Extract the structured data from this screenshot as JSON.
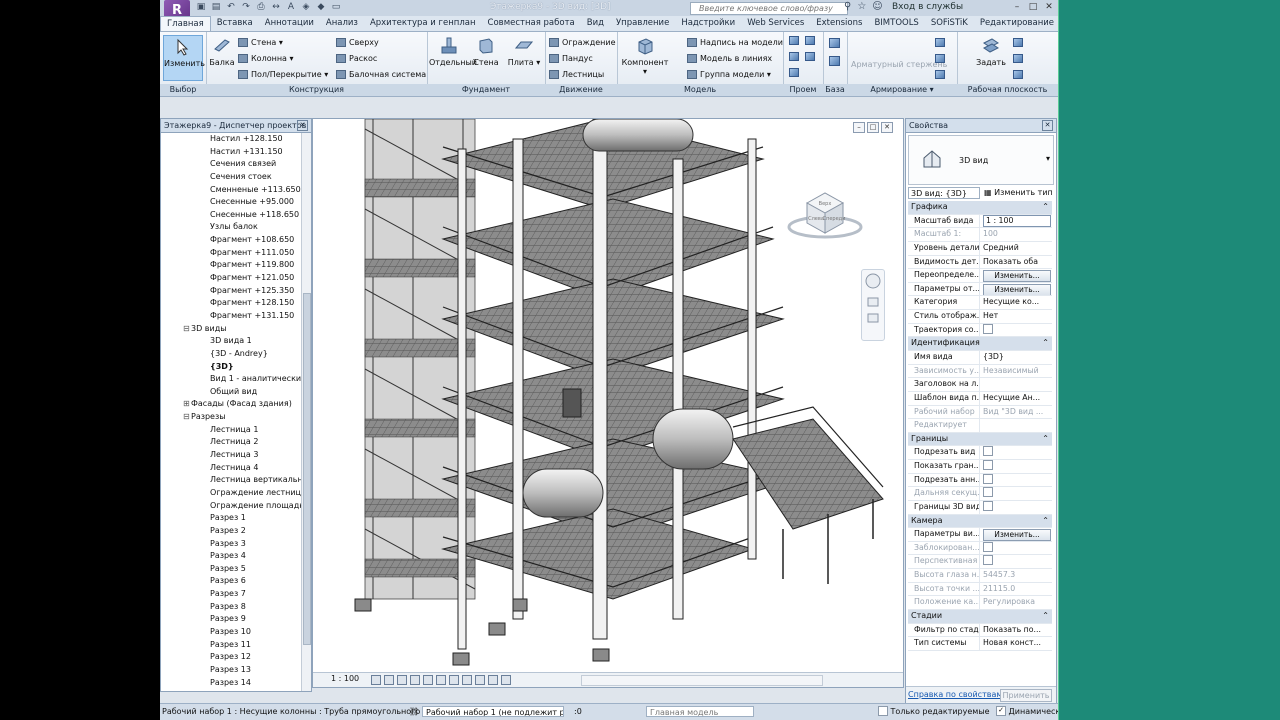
{
  "window": {
    "title": "Этажерка9 - 3D вид: [3D]",
    "search_placeholder": "Введите ключевое слово/фразу",
    "signin": "Вход в службы"
  },
  "tabs": [
    "Главная",
    "Вставка",
    "Аннотации",
    "Анализ",
    "Архитектура и генплан",
    "Совместная работа",
    "Вид",
    "Управление",
    "Надстройки",
    "Web Services",
    "Extensions",
    "BIMTOOLS",
    "SOFiSTiK",
    "Редактирование"
  ],
  "active_tab": "Главная",
  "ribbon": {
    "select": {
      "button": "Изменить",
      "title": "Выбор"
    },
    "structure": {
      "title": "Конструкция",
      "beam": "Балка",
      "wall": "Стена",
      "column": "Колонна",
      "floor": "Пол/Перекрытие",
      "truss": "Сверху",
      "brace": "Раскос",
      "beam_system": "Балочная система"
    },
    "foundation": {
      "title": "Фундамент",
      "isolated": "Отдельный",
      "wall": "Стена",
      "slab": "Плита"
    },
    "circulation": {
      "title": "Движение",
      "railing": "Ограждение",
      "ramp": "Пандус",
      "stair": "Лестницы"
    },
    "model": {
      "title": "Модель",
      "component": "Компонент",
      "model_text": "Надпись на модели",
      "model_line": "Модель в линиях",
      "model_group": "Группа модели"
    },
    "opening": {
      "title": "Проем"
    },
    "datum": {
      "title": "База"
    },
    "reinforcement": {
      "title": "Армирование",
      "rebar_area": "Арматурный стержень"
    },
    "workplane": {
      "title": "Рабочая плоскость",
      "set": "Задать"
    }
  },
  "project_browser": {
    "title": "Этажерка9 - Диспетчер проектов",
    "items": [
      {
        "label": "Настил +128.150",
        "level": 2
      },
      {
        "label": "Настил +131.150",
        "level": 2
      },
      {
        "label": "Сечения связей",
        "level": 2
      },
      {
        "label": "Сечения стоек",
        "level": 2
      },
      {
        "label": "Сменненые +113.650",
        "level": 2
      },
      {
        "label": "Снесенные +95.000",
        "level": 2
      },
      {
        "label": "Снесенные +118.650",
        "level": 2
      },
      {
        "label": "Узлы балок",
        "level": 2
      },
      {
        "label": "Фрагмент +108.650",
        "level": 2
      },
      {
        "label": "Фрагмент +111.050",
        "level": 2
      },
      {
        "label": "Фрагмент +119.800",
        "level": 2
      },
      {
        "label": "Фрагмент +121.050",
        "level": 2
      },
      {
        "label": "Фрагмент +125.350",
        "level": 2
      },
      {
        "label": "Фрагмент +128.150",
        "level": 2
      },
      {
        "label": "Фрагмент +131.150",
        "level": 2
      },
      {
        "label": "3D виды",
        "level": 1,
        "toggle": "⊟"
      },
      {
        "label": "3D вида 1",
        "level": 2
      },
      {
        "label": "{3D - Andrey}",
        "level": 2
      },
      {
        "label": "{3D}",
        "level": 2,
        "selected": true
      },
      {
        "label": "Вид 1 - аналитически",
        "level": 2
      },
      {
        "label": "Общий вид",
        "level": 2
      },
      {
        "label": "Фасады (Фасад здания)",
        "level": 1,
        "toggle": "⊞"
      },
      {
        "label": "Разрезы",
        "level": 1,
        "toggle": "⊟"
      },
      {
        "label": "Лестница 1",
        "level": 2
      },
      {
        "label": "Лестница 2",
        "level": 2
      },
      {
        "label": "Лестница 3",
        "level": 2
      },
      {
        "label": "Лестница 4",
        "level": 2
      },
      {
        "label": "Лестница вертикальна",
        "level": 2
      },
      {
        "label": "Ограждение лестница",
        "level": 2
      },
      {
        "label": "Ограждение площадк",
        "level": 2
      },
      {
        "label": "Разрез 1",
        "level": 2
      },
      {
        "label": "Разрез 2",
        "level": 2
      },
      {
        "label": "Разрез 3",
        "level": 2
      },
      {
        "label": "Разрез 4",
        "level": 2
      },
      {
        "label": "Разрез 5",
        "level": 2
      },
      {
        "label": "Разрез 6",
        "level": 2
      },
      {
        "label": "Разрез 7",
        "level": 2
      },
      {
        "label": "Разрез 8",
        "level": 2
      },
      {
        "label": "Разрез 9",
        "level": 2
      },
      {
        "label": "Разрез 10",
        "level": 2
      },
      {
        "label": "Разрез 11",
        "level": 2
      },
      {
        "label": "Разрез 12",
        "level": 2
      },
      {
        "label": "Разрез 13",
        "level": 2
      },
      {
        "label": "Разрез 14",
        "level": 2
      }
    ]
  },
  "viewport": {
    "scale": "1 : 100",
    "viewcube_top": "Верх",
    "viewcube_left": "Слева",
    "viewcube_front": "Спереди"
  },
  "properties": {
    "title": "Свойства",
    "type_name": "3D вид",
    "type_selector": "3D вид: {3D}",
    "edit_type": "Изменить тип",
    "rows": [
      {
        "section": "Графика"
      },
      {
        "key": "Масштаб вида",
        "value": "1 : 100",
        "kind": "input"
      },
      {
        "key": "Масштаб  1:",
        "value": "100",
        "kind": "disabled"
      },
      {
        "key": "Уровень детали...",
        "value": "Средний"
      },
      {
        "key": "Видимость дет...",
        "value": "Показать оба"
      },
      {
        "key": "Переопределе...",
        "value": "Изменить...",
        "kind": "button"
      },
      {
        "key": "Параметры от...",
        "value": "Изменить...",
        "kind": "button"
      },
      {
        "key": "Категория",
        "value": "Несущие ко..."
      },
      {
        "key": "Стиль отображ...",
        "value": "Нет"
      },
      {
        "key": "Траектория со...",
        "value": "",
        "kind": "check"
      },
      {
        "section": "Идентификация"
      },
      {
        "key": "Имя вида",
        "value": "{3D}"
      },
      {
        "key": "Зависимость у...",
        "value": "Независимый",
        "kind": "disabled"
      },
      {
        "key": "Заголовок на л...",
        "value": ""
      },
      {
        "key": "Шаблон вида п...",
        "value": "Несущие Ан..."
      },
      {
        "key": "Рабочий набор",
        "value": "Вид \"3D вид ...",
        "kind": "disabled"
      },
      {
        "key": "Редактирует",
        "value": "",
        "kind": "disabled"
      },
      {
        "section": "Границы"
      },
      {
        "key": "Подрезать вид",
        "value": "",
        "kind": "check"
      },
      {
        "key": "Показать гран...",
        "value": "",
        "kind": "check"
      },
      {
        "key": "Подрезать анн...",
        "value": "",
        "kind": "check"
      },
      {
        "key": "Дальняя секущ...",
        "value": "",
        "kind": "check-disabled"
      },
      {
        "key": "Границы 3D вида",
        "value": "",
        "kind": "check"
      },
      {
        "section": "Камера"
      },
      {
        "key": "Параметры ви...",
        "value": "Изменить...",
        "kind": "button"
      },
      {
        "key": "Заблокирован...",
        "value": "",
        "kind": "check-disabled"
      },
      {
        "key": "Перспективная",
        "value": "",
        "kind": "check-disabled"
      },
      {
        "key": "Высота глаза н...",
        "value": "54457.3",
        "kind": "disabled"
      },
      {
        "key": "Высота точки ...",
        "value": "21115.0",
        "kind": "disabled"
      },
      {
        "key": "Положение ка...",
        "value": "Регулировка",
        "kind": "disabled"
      },
      {
        "section": "Стадии"
      },
      {
        "key": "Фильтр по стад...",
        "value": "Показать по..."
      },
      {
        "key": "Тип системы",
        "value": "Новая конст..."
      }
    ],
    "help_link": "Справка по свойствам",
    "apply": "Применить"
  },
  "statusbar": {
    "message": "Рабочий набор 1 : Несущие колонны : Труба прямоугольного",
    "workset": "Рабочий набор 1 (не подлежит ре",
    "count": ":0",
    "model": "Главная модель",
    "editable_only": "Только редактируемые",
    "dynamic": "Динамически"
  }
}
